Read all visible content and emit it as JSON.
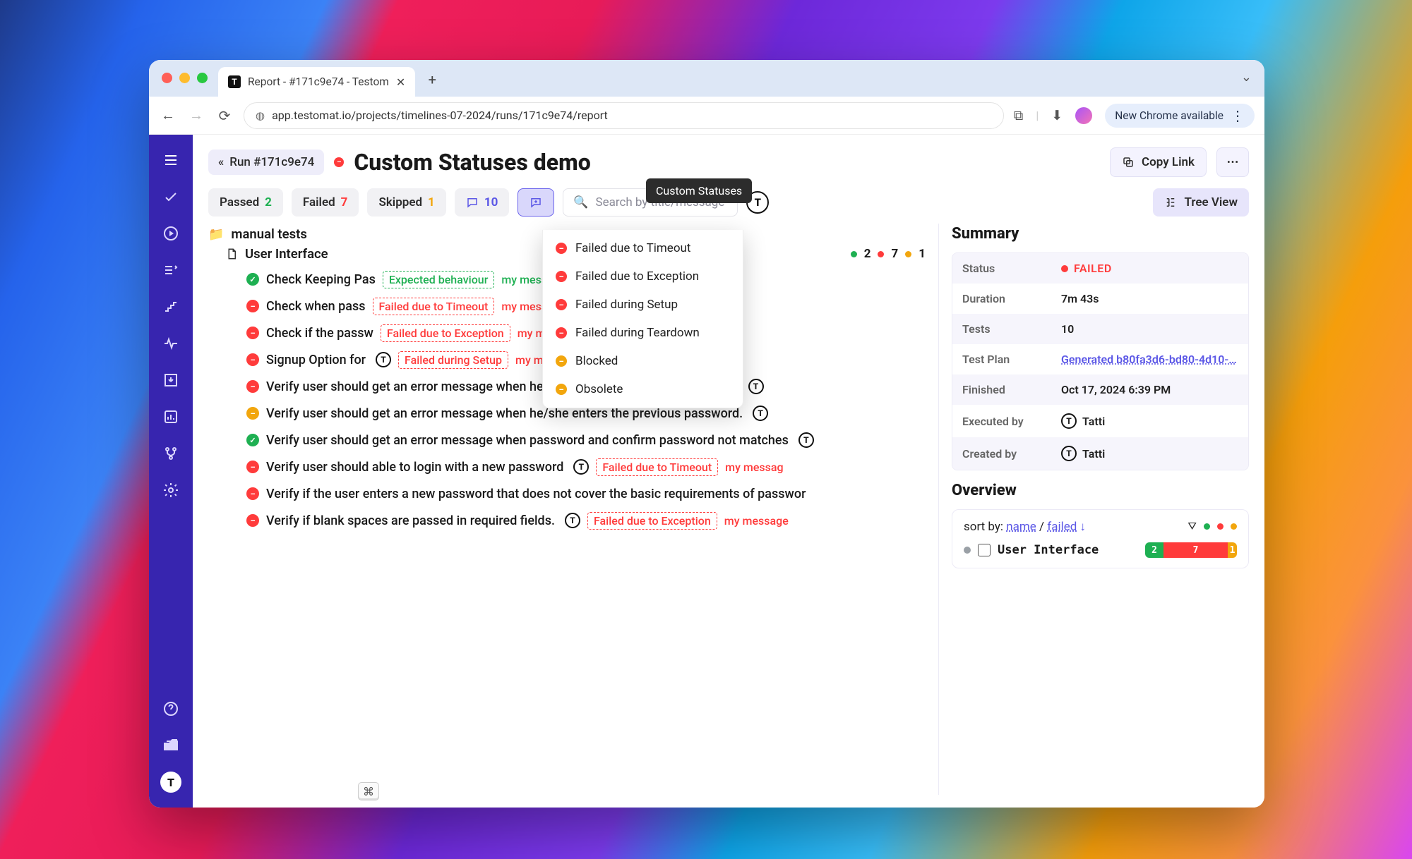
{
  "browser": {
    "tab_title": "Report - #171c9e74 - Testom",
    "url": "app.testomat.io/projects/timelines-07-2024/runs/171c9e74/report",
    "new_chrome_pill": "New Chrome available"
  },
  "header": {
    "back_chip": "Run #171c9e74",
    "title": "Custom Statuses demo",
    "copy_link": "Copy Link"
  },
  "tooltip": "Custom Statuses",
  "filters": {
    "passed_label": "Passed",
    "passed_count": "2",
    "failed_label": "Failed",
    "failed_count": "7",
    "skipped_label": "Skipped",
    "skipped_count": "1",
    "messages_count": "10",
    "search_placeholder": "Search by title/message",
    "tree_view": "Tree View"
  },
  "status_dropdown": [
    {
      "dot": "fail",
      "label": "Failed due to Timeout"
    },
    {
      "dot": "fail",
      "label": "Failed due to Exception"
    },
    {
      "dot": "fail",
      "label": "Failed during Setup"
    },
    {
      "dot": "fail",
      "label": "Failed during Teardown"
    },
    {
      "dot": "warn",
      "label": "Blocked"
    },
    {
      "dot": "warn",
      "label": "Obsolete"
    }
  ],
  "tree": {
    "folder": "manual tests",
    "suite": "User Interface",
    "suite_stats": {
      "pass": "2",
      "fail": "7",
      "skip": "1"
    }
  },
  "tests": [
    {
      "status": "pass",
      "title": "Check Keeping Pas",
      "badge": "Expected behaviour",
      "badge_kind": "green",
      "msg": "my message text"
    },
    {
      "status": "fail",
      "title": "Check when pass ",
      "badge": "Failed due to Timeout",
      "badge_kind": "red",
      "msg": "my message text"
    },
    {
      "status": "fail",
      "title": "Check if the passw",
      "badge": "Failed due to Exception",
      "badge_kind": "red",
      "msg": "my message text"
    },
    {
      "status": "fail",
      "title": "Signup Option for",
      "badge": "Failed during Setup",
      "badge_kind": "red",
      "msg": "my message text",
      "t_badge": true
    },
    {
      "status": "fail",
      "title": "Verify user should get an error message when he/she enters not registered email id",
      "t_badge": true
    },
    {
      "status": "skip",
      "title": "Verify user should get an error message when he/she enters the previous password.",
      "t_badge": true
    },
    {
      "status": "pass",
      "title": "Verify user should get an error message when password and confirm password not matches",
      "t_badge": true
    },
    {
      "status": "fail",
      "title": "Verify user should able to login with a new password",
      "t_badge": true,
      "badge": "Failed due to Timeout",
      "badge_kind": "red",
      "msg": "my messag"
    },
    {
      "status": "fail",
      "title": "Verify if the user enters a new password that does not cover the basic requirements of passwor"
    },
    {
      "status": "fail",
      "title": "Verify if blank spaces are passed in required fields.",
      "t_badge": true,
      "badge": "Failed due to Exception",
      "badge_kind": "red",
      "msg": "my message"
    }
  ],
  "summary": {
    "title": "Summary",
    "rows": {
      "status_k": "Status",
      "status_v": "FAILED",
      "duration_k": "Duration",
      "duration_v": "7m 43s",
      "tests_k": "Tests",
      "tests_v": "10",
      "plan_k": "Test Plan",
      "plan_v": "Generated b80fa3d6-bd80-4d10-…",
      "finished_k": "Finished",
      "finished_v": "Oct 17, 2024 6:39 PM",
      "exec_k": "Executed by",
      "exec_v": "Tatti",
      "created_k": "Created by",
      "created_v": "Tatti"
    }
  },
  "overview": {
    "title": "Overview",
    "sort_prefix": "sort by: ",
    "sort_name": "name",
    "sort_sep": " / ",
    "sort_failed": "failed",
    "suite_label": "User Interface",
    "bar": {
      "pass": "2",
      "fail": "7",
      "skip": "1"
    }
  }
}
